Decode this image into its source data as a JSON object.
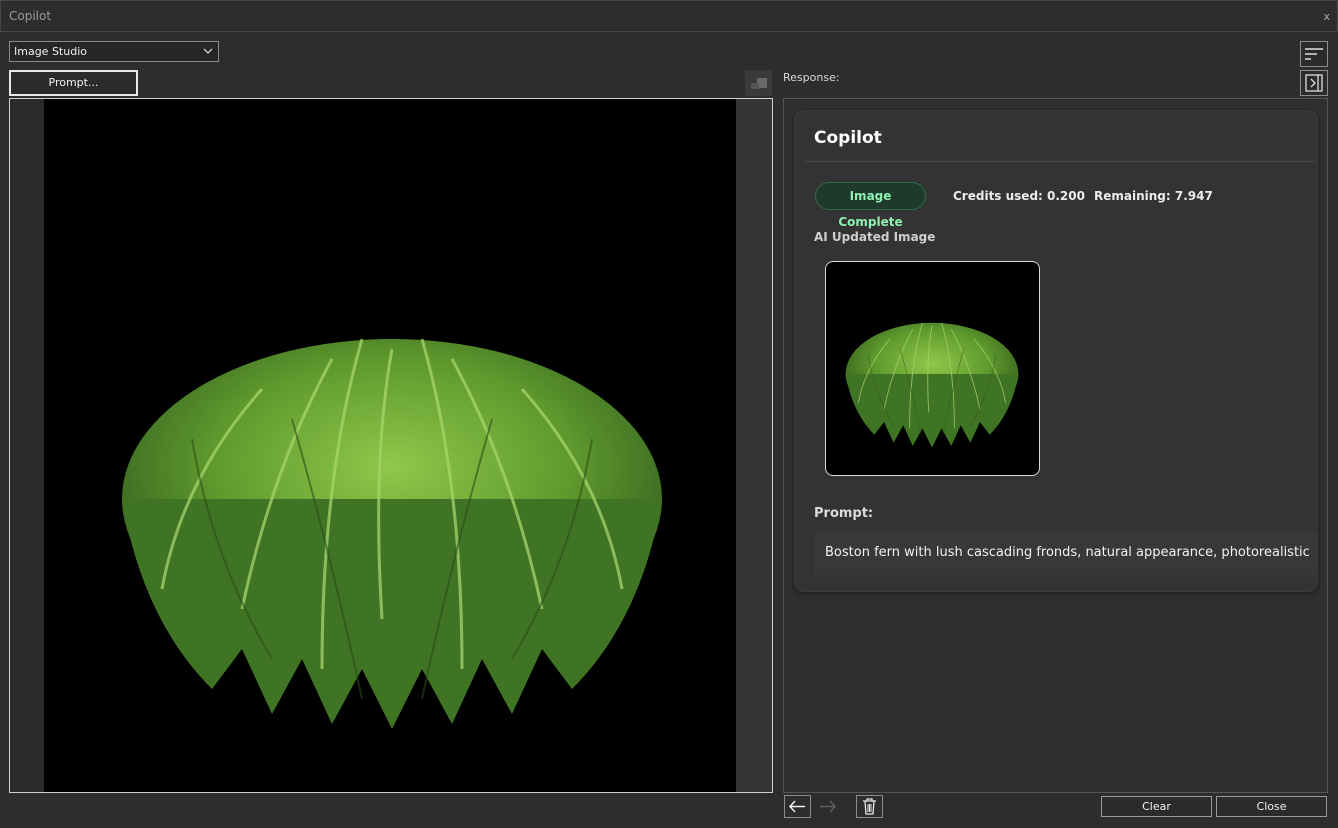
{
  "window": {
    "title": "Copilot",
    "close_glyph": "x"
  },
  "toolbar": {
    "mode_select_value": "Image Studio",
    "prompt_button_label": "Prompt...",
    "response_label": "Response:",
    "sort_icon": "sort-lines-icon",
    "collapse_icon": "collapse-panel-icon"
  },
  "canvas": {
    "image_subject": "Boston fern"
  },
  "response": {
    "title": "Copilot",
    "status_badge": "Image Complete",
    "credits_used": "Credits used: 0.200",
    "remaining": "Remaining: 7.947",
    "image_section_label": "AI Updated Image",
    "prompt_label": "Prompt:",
    "prompt_text": "Boston fern with lush cascading fronds, natural appearance, photorealistic"
  },
  "footer": {
    "back_icon": "arrow-left-icon",
    "forward_icon": "arrow-right-icon",
    "trash_icon": "trash-icon",
    "clear_label": "Clear",
    "close_label": "Close"
  },
  "colors": {
    "background": "#2d2d2d",
    "accent_green_text": "#8ff0b0",
    "badge_background": "#1f3a2c",
    "fern_light": "#7fb83a",
    "fern_dark": "#2f5a1c"
  }
}
